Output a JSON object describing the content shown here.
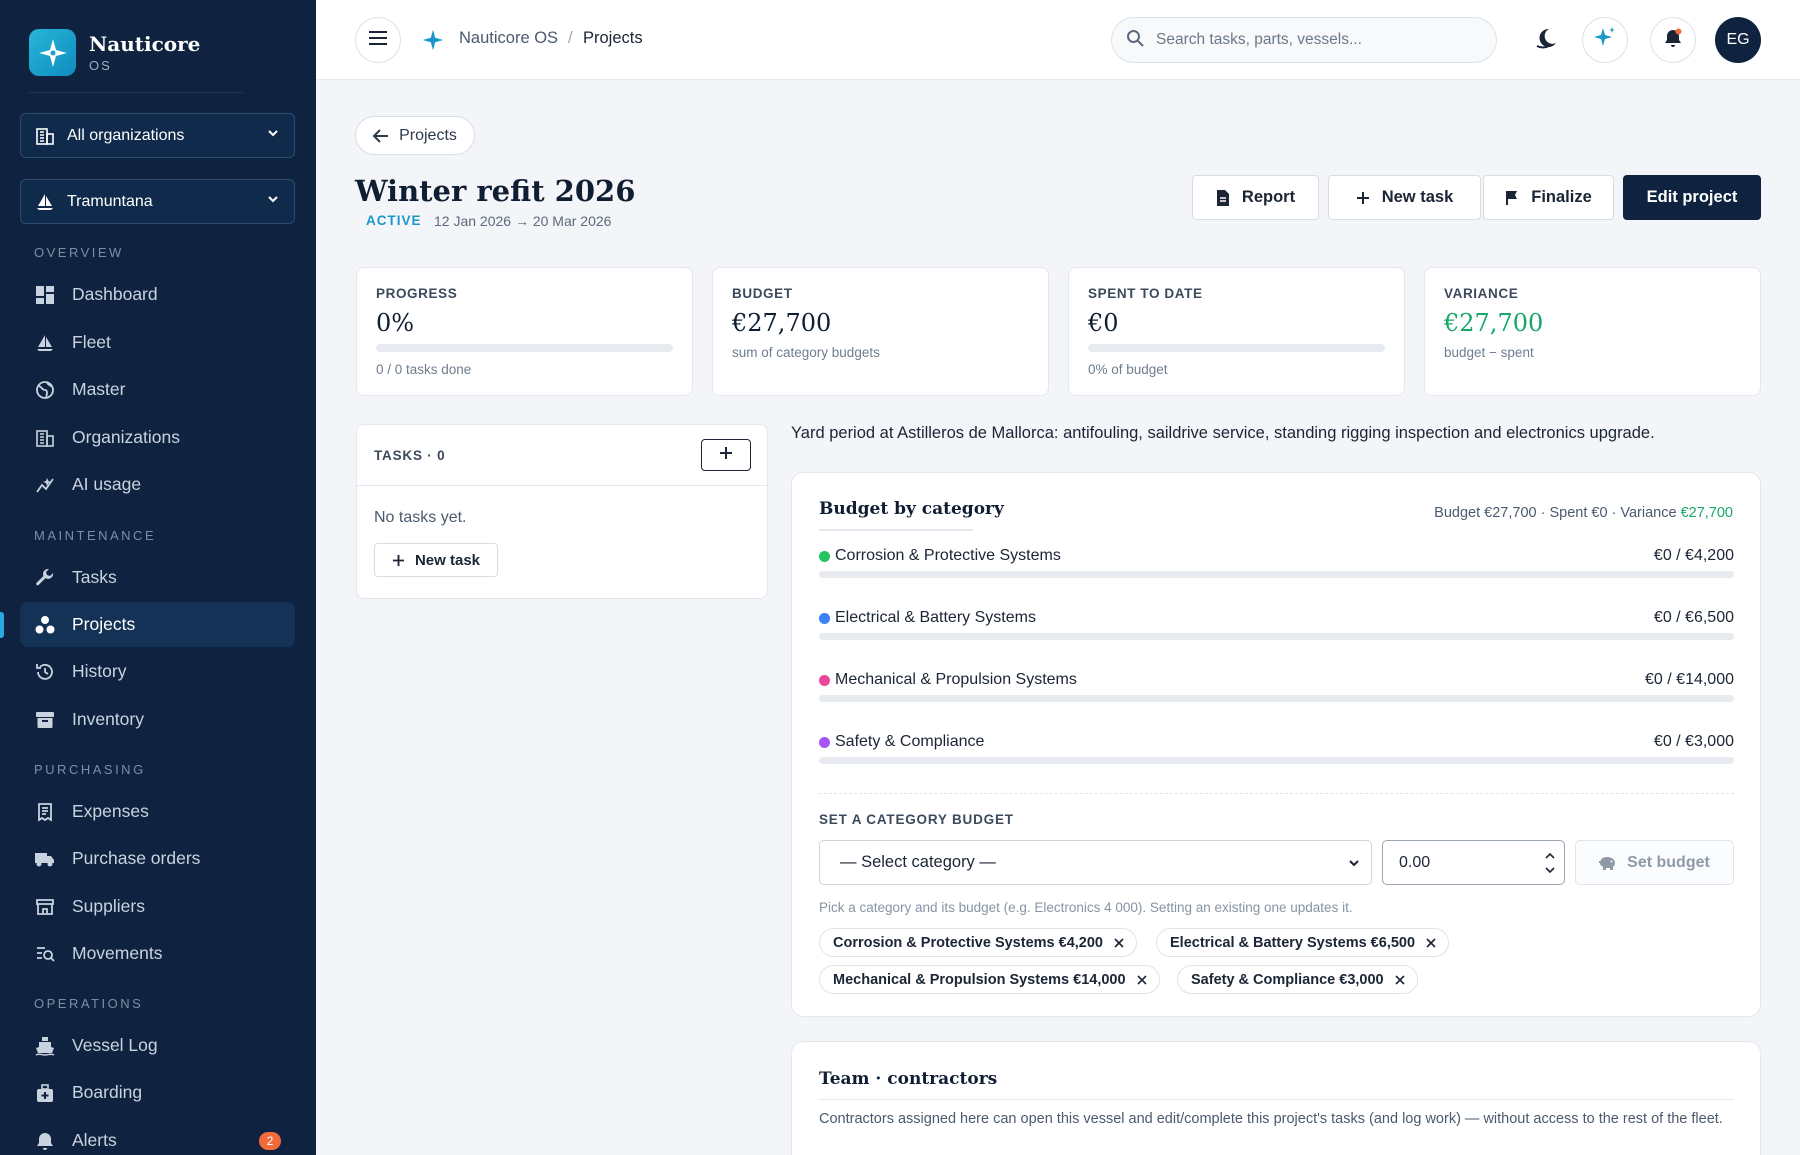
{
  "app": {
    "name": "Nauticore",
    "sub": "OS"
  },
  "sidebar": {
    "org_selector": "All organizations",
    "vessel_selector": "Tramuntana",
    "sections": {
      "overview": "OVERVIEW",
      "maintenance": "MAINTENANCE",
      "purchasing": "PURCHASING",
      "operations": "OPERATIONS"
    },
    "items": [
      {
        "label": "Dashboard",
        "icon": "dashboard-icon"
      },
      {
        "label": "Fleet",
        "icon": "sailboat-icon"
      },
      {
        "label": "Master",
        "icon": "globe-icon"
      },
      {
        "label": "Organizations",
        "icon": "building-icon"
      },
      {
        "label": "AI usage",
        "icon": "chart-icon"
      },
      {
        "label": "Tasks",
        "icon": "wrench-icon"
      },
      {
        "label": "Projects",
        "icon": "projects-icon",
        "active": true
      },
      {
        "label": "History",
        "icon": "history-icon"
      },
      {
        "label": "Inventory",
        "icon": "archive-icon"
      },
      {
        "label": "Expenses",
        "icon": "receipt-icon"
      },
      {
        "label": "Purchase orders",
        "icon": "truck-icon"
      },
      {
        "label": "Suppliers",
        "icon": "store-icon"
      },
      {
        "label": "Movements",
        "icon": "movements-icon"
      },
      {
        "label": "Vessel Log",
        "icon": "ship-icon"
      },
      {
        "label": "Boarding",
        "icon": "boarding-icon"
      },
      {
        "label": "Alerts",
        "icon": "bell-icon",
        "badge": "2"
      }
    ]
  },
  "topbar": {
    "breadcrumb": [
      "Nauticore OS",
      "Projects"
    ],
    "breadcrumb_sep": "/",
    "search_placeholder": "Search tasks, parts, vessels...",
    "avatar": "EG"
  },
  "project": {
    "back_label": "Projects",
    "title": "Winter refit 2026",
    "status": "ACTIVE",
    "dates": "12 Jan 2026 → 20 Mar 2026",
    "actions": {
      "report": "Report",
      "new_task": "New task",
      "finalize": "Finalize",
      "edit": "Edit project"
    },
    "description": "Yard period at Astilleros de Mallorca: antifouling, saildrive service, standing rigging inspection and electronics upgrade."
  },
  "stats": [
    {
      "label": "PROGRESS",
      "value": "0%",
      "sub": "0 / 0 tasks done",
      "progress": 0
    },
    {
      "label": "BUDGET",
      "value": "€27,700",
      "sub": "sum of category budgets"
    },
    {
      "label": "SPENT TO DATE",
      "value": "€0",
      "sub": "0% of budget",
      "progress": 0
    },
    {
      "label": "VARIANCE",
      "value": "€27,700",
      "sub": "budget − spent"
    }
  ],
  "tasks": {
    "title": "TASKS · 0",
    "empty": "No tasks yet.",
    "new_task": "New task"
  },
  "budget": {
    "title": "Budget by category",
    "summary_prefix": "Budget €27,700 · Spent €0 · Variance ",
    "summary_variance": "€27,700",
    "categories": [
      {
        "name": "Corrosion & Protective Systems",
        "amount": "€0 / €4,200",
        "color": "#22c55e"
      },
      {
        "name": "Electrical & Battery Systems",
        "amount": "€0 / €6,500",
        "color": "#3b82f6"
      },
      {
        "name": "Mechanical & Propulsion Systems",
        "amount": "€0 / €14,000",
        "color": "#ec4899"
      },
      {
        "name": "Safety & Compliance",
        "amount": "€0 / €3,000",
        "color": "#a855f7"
      }
    ],
    "set_title": "SET A CATEGORY BUDGET",
    "select_placeholder": "— Select category —",
    "amount_value": "0.00",
    "set_button": "Set budget",
    "help": "Pick a category and its budget (e.g. Electronics 4 000). Setting an existing one updates it.",
    "chips": [
      "Corrosion & Protective Systems €4,200",
      "Electrical & Battery Systems €6,500",
      "Mechanical & Propulsion Systems €14,000",
      "Safety & Compliance €3,000"
    ]
  },
  "team": {
    "title": "Team · contractors",
    "description": "Contractors assigned here can open this vessel and edit/complete this project's tasks (and log work) — without access to the rest of the fleet."
  }
}
